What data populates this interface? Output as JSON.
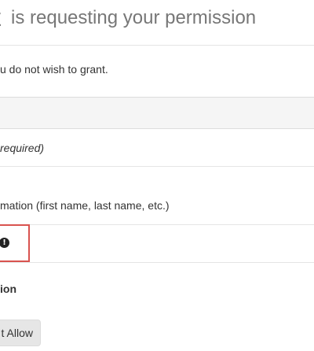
{
  "header": {
    "app_name_fragment": "t",
    "title_rest": "is requesting your permission"
  },
  "intro_text": "u do not wish to grant.",
  "required_note": "required)",
  "info_item": "mation (first name, last name, etc.)",
  "warning": {
    "icon": "exclamation-circle-icon",
    "accent_color": "#d9534f"
  },
  "section_heading": "ion",
  "buttons": {
    "allow_label": "t Allow"
  }
}
